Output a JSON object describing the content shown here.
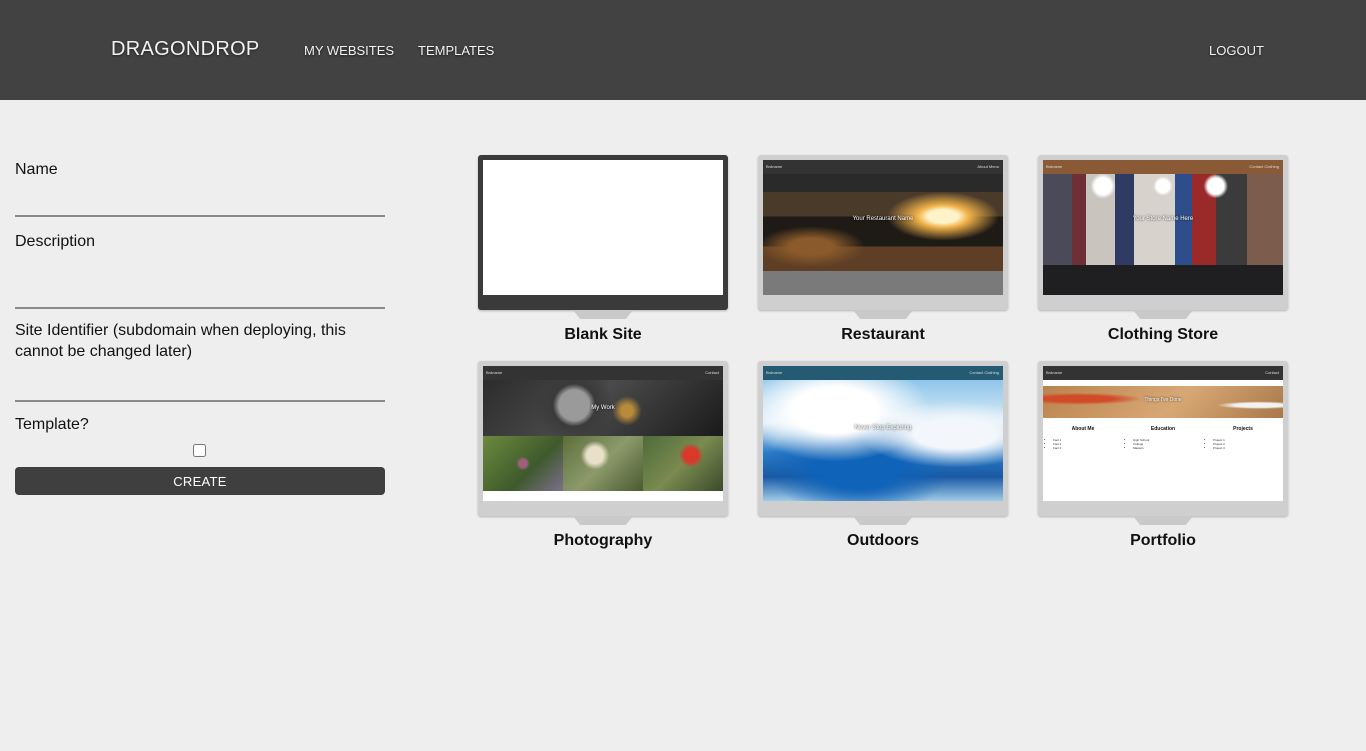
{
  "header": {
    "brand": "DRAGONDROP",
    "nav": {
      "my_websites": "MY WEBSITES",
      "templates": "TEMPLATES",
      "logout": "LOGOUT"
    },
    "background_color": "#424242"
  },
  "form": {
    "name_label": "Name",
    "name_value": "",
    "description_label": "Description",
    "description_value": "",
    "site_identifier_label": "Site Identifier (subdomain when deploying, this cannot be changed later)",
    "site_identifier_value": "",
    "template_label": "Template?",
    "template_checked": false,
    "create_label": "CREATE"
  },
  "templates": [
    {
      "title": "Blank Site"
    },
    {
      "title": "Restaurant",
      "nav_brand": "Brdname",
      "nav_links": "About   Menu",
      "hero_text": "Your Restaurant Name"
    },
    {
      "title": "Clothing Store",
      "nav_brand": "Brdname",
      "nav_links": "Contact   Clothing",
      "hero_text": "Your Store Name Here"
    },
    {
      "title": "Photography",
      "nav_brand": "Brdname",
      "nav_links": "Contact",
      "hero_text": "My Work"
    },
    {
      "title": "Outdoors",
      "nav_brand": "Brdname",
      "nav_links": "Contact   Clothing",
      "hero_text": "Never Stop Exploring"
    },
    {
      "title": "Portfolio",
      "nav_brand": "Brdname",
      "nav_links": "Contact",
      "hero_text": "Things I've Done",
      "columns": [
        {
          "heading": "About Me",
          "items": [
            "Fact 1",
            "Fact 2",
            "Fact 3"
          ]
        },
        {
          "heading": "Education",
          "items": [
            "High School",
            "College",
            "Masters"
          ]
        },
        {
          "heading": "Projects",
          "items": [
            "Project 1",
            "Project 2",
            "Project 3"
          ]
        }
      ]
    }
  ]
}
